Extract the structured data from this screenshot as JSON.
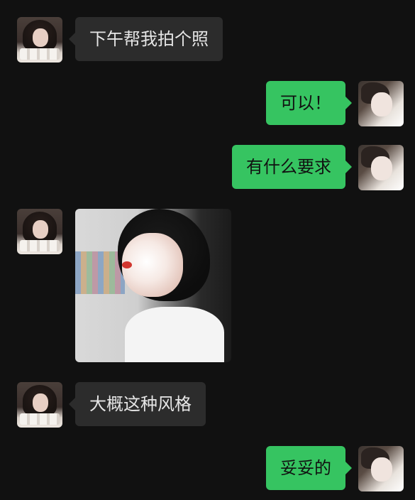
{
  "conversation": {
    "messages": [
      {
        "sender": "her",
        "text": "下午帮我拍个照"
      },
      {
        "sender": "me",
        "text": "可以！"
      },
      {
        "sender": "me",
        "text": "有什么要求"
      },
      {
        "sender": "her",
        "type": "photo"
      },
      {
        "sender": "her",
        "text": "大概这种风格"
      },
      {
        "sender": "me",
        "text": "妥妥的"
      }
    ]
  },
  "colors": {
    "background": "#111111",
    "incoming_bubble": "#2c2c2c",
    "outgoing_bubble": "#36c461"
  },
  "icons": {
    "contact_avatar": "avatar-her",
    "self_avatar": "avatar-me",
    "shared_photo": "photo-girl-portrait"
  }
}
